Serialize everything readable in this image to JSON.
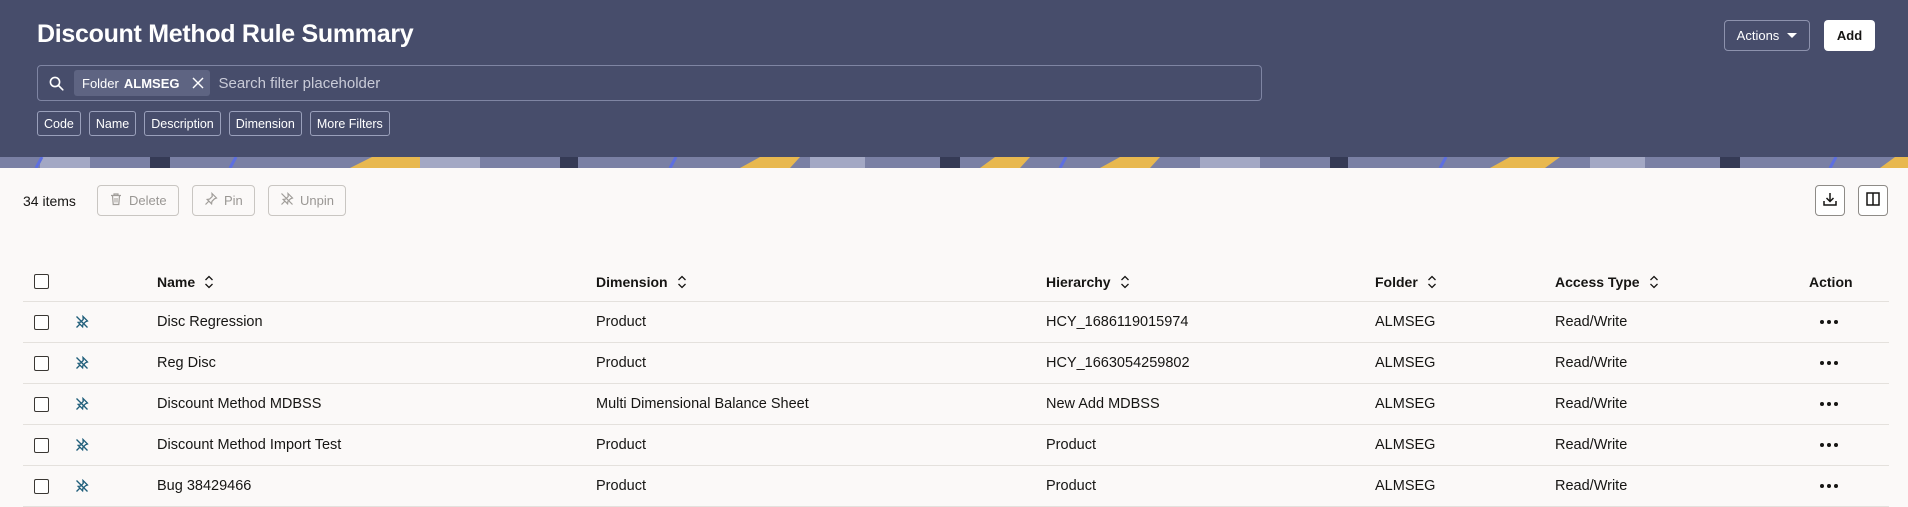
{
  "header": {
    "title": "Discount Method Rule Summary",
    "actions_label": "Actions",
    "add_label": "Add",
    "search": {
      "chip_prefix": "Folder",
      "chip_value": "ALMSEG",
      "placeholder": "Search filter placeholder"
    },
    "filters": [
      "Code",
      "Name",
      "Description",
      "Dimension",
      "More Filters"
    ]
  },
  "toolbar": {
    "count_label": "34 items",
    "delete_label": "Delete",
    "pin_label": "Pin",
    "unpin_label": "Unpin"
  },
  "table": {
    "columns": [
      "Name",
      "Dimension",
      "Hierarchy",
      "Folder",
      "Access Type",
      "Action"
    ],
    "rows": [
      {
        "name": "Disc Regression",
        "dimension": "Product",
        "hierarchy": "HCY_1686119015974",
        "folder": "ALMSEG",
        "access": "Read/Write"
      },
      {
        "name": "Reg Disc",
        "dimension": "Product",
        "hierarchy": "HCY_1663054259802",
        "folder": "ALMSEG",
        "access": "Read/Write"
      },
      {
        "name": "Discount Method MDBSS",
        "dimension": "Multi Dimensional Balance Sheet",
        "hierarchy": "New Add MDBSS",
        "folder": "ALMSEG",
        "access": "Read/Write"
      },
      {
        "name": "Discount Method Import Test",
        "dimension": "Product",
        "hierarchy": "Product",
        "folder": "ALMSEG",
        "access": "Read/Write"
      },
      {
        "name": "Bug 38429466",
        "dimension": "Product",
        "hierarchy": "Product",
        "folder": "ALMSEG",
        "access": "Read/Write"
      }
    ]
  },
  "icons": {
    "search": "search-icon",
    "clear": "close-icon",
    "delete": "trash-icon",
    "pin": "pin-icon",
    "unpin": "unpin-icon",
    "download": "download-icon",
    "columns": "columns-icon",
    "sort": "sort-icon",
    "more": "more-horizontal-icon"
  },
  "colors": {
    "header_bg": "#474d6b",
    "page_bg": "#fbf9f8",
    "unpin_icon": "#1f5e7a"
  }
}
